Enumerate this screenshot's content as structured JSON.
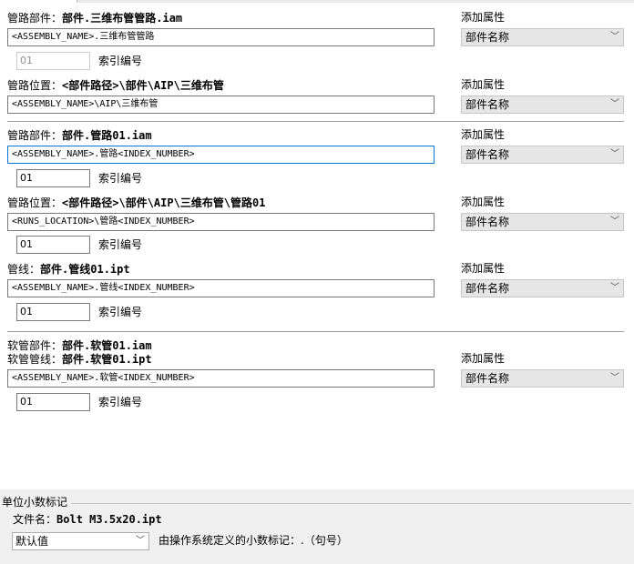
{
  "header": {
    "tabs": [
      ""
    ]
  },
  "rows": {
    "r1": {
      "label_prefix": "管路部件：",
      "label_value": "部件.三维布管管路.iam",
      "input": "<ASSEMBLY_NAME>.三维布管管路",
      "index": "01",
      "index_label": "索引编号",
      "add_label": "添加属性",
      "combo": "部件名称"
    },
    "r2": {
      "label_prefix": "管路位置：",
      "label_value": "<部件路径>\\部件\\AIP\\三维布管",
      "input": "<ASSEMBLY_NAME>\\AIP\\三维布管",
      "add_label": "添加属性",
      "combo": "部件名称"
    },
    "r3": {
      "label_prefix": "管路部件：",
      "label_value": "部件.管路01.iam",
      "input": "<ASSEMBLY_NAME>.管路<INDEX_NUMBER>",
      "index": "01",
      "index_label": "索引编号",
      "add_label": "添加属性",
      "combo": "部件名称"
    },
    "r4": {
      "label_prefix": "管路位置：",
      "label_value": "<部件路径>\\部件\\AIP\\三维布管\\管路01",
      "input": "<RUNS_LOCATION>\\管路<INDEX_NUMBER>",
      "index": "01",
      "index_label": "索引编号",
      "add_label": "添加属性",
      "combo": "部件名称"
    },
    "r5": {
      "label_prefix": "管线：",
      "label_value": "部件.管线01.ipt",
      "input": "<ASSEMBLY_NAME>.管线<INDEX_NUMBER>",
      "index": "01",
      "index_label": "索引编号",
      "add_label": "添加属性",
      "combo": "部件名称"
    },
    "r6": {
      "label_prefix": "软管部件：",
      "label_value": "部件.软管01.iam",
      "label2_prefix": "软管管线：",
      "label2_value": "部件.软管01.ipt",
      "input": "<ASSEMBLY_NAME>.软管<INDEX_NUMBER>",
      "index": "01",
      "index_label": "索引编号",
      "add_label": "添加属性",
      "combo": "部件名称"
    }
  },
  "bottom": {
    "group_title": "单位小数标记",
    "file_prefix": "文件名：",
    "file_value": "Bolt M3.5x20.ipt",
    "select": "默认值",
    "desc": "由操作系统定义的小数标记：.（句号）"
  },
  "colors": {
    "focus": "#0078d7",
    "panel": "#f0f0f0",
    "combo_bg": "#e6e6e6"
  }
}
